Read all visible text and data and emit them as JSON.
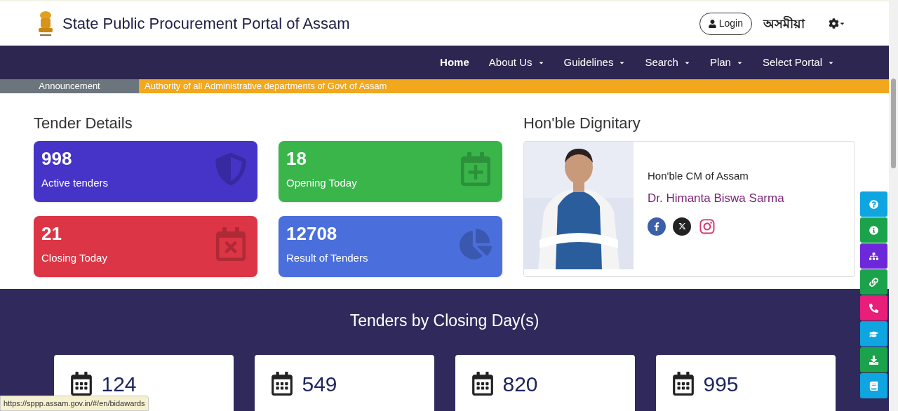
{
  "header": {
    "title": "State Public Procurement Portal of Assam",
    "login": "Login",
    "language": "অসমীয়া"
  },
  "nav": [
    {
      "label": "Home",
      "selected": true,
      "dropdown": false
    },
    {
      "label": "About Us",
      "selected": false,
      "dropdown": true
    },
    {
      "label": "Guidelines",
      "selected": false,
      "dropdown": true
    },
    {
      "label": "Search",
      "selected": false,
      "dropdown": true
    },
    {
      "label": "Plan",
      "selected": false,
      "dropdown": true
    },
    {
      "label": "Select Portal",
      "selected": false,
      "dropdown": true
    }
  ],
  "announcement": {
    "label": "Announcement",
    "text": "Authority of all Administrative departments of Govt of Assam"
  },
  "tender_details": {
    "title": "Tender Details",
    "cards": [
      {
        "count": "998",
        "label": "Active tenders",
        "color": "#4634c8",
        "kind": "shield"
      },
      {
        "count": "18",
        "label": "Opening Today",
        "color": "#39b54a",
        "kind": "calendar-plus"
      },
      {
        "count": "21",
        "label": "Closing Today",
        "color": "#dc3545",
        "kind": "calendar-x"
      },
      {
        "count": "12708",
        "label": "Result of Tenders",
        "color": "#4a6fdc",
        "kind": "pie"
      }
    ]
  },
  "dignitary": {
    "title": "Hon'ble Dignitary",
    "role": "Hon'ble CM of Assam",
    "name": "Dr. Himanta Biswa Sarma"
  },
  "closing_days": {
    "title": "Tenders by Closing Day(s)",
    "cards": [
      {
        "count": "124"
      },
      {
        "count": "549"
      },
      {
        "count": "820"
      },
      {
        "count": "995"
      }
    ]
  },
  "side_buttons": [
    {
      "kind": "help",
      "color": "#0ea5e0"
    },
    {
      "kind": "info",
      "color": "#1aa34a"
    },
    {
      "kind": "sitemap",
      "color": "#6d28d9"
    },
    {
      "kind": "link",
      "color": "#1aa34a"
    },
    {
      "kind": "phone",
      "color": "#e91e7a"
    },
    {
      "kind": "graduation",
      "color": "#0ea5e0"
    },
    {
      "kind": "download",
      "color": "#1aa34a"
    },
    {
      "kind": "book",
      "color": "#0ea5e0"
    }
  ],
  "status_url": "https://sppp.assam.gov.in/#/en/bidawards"
}
